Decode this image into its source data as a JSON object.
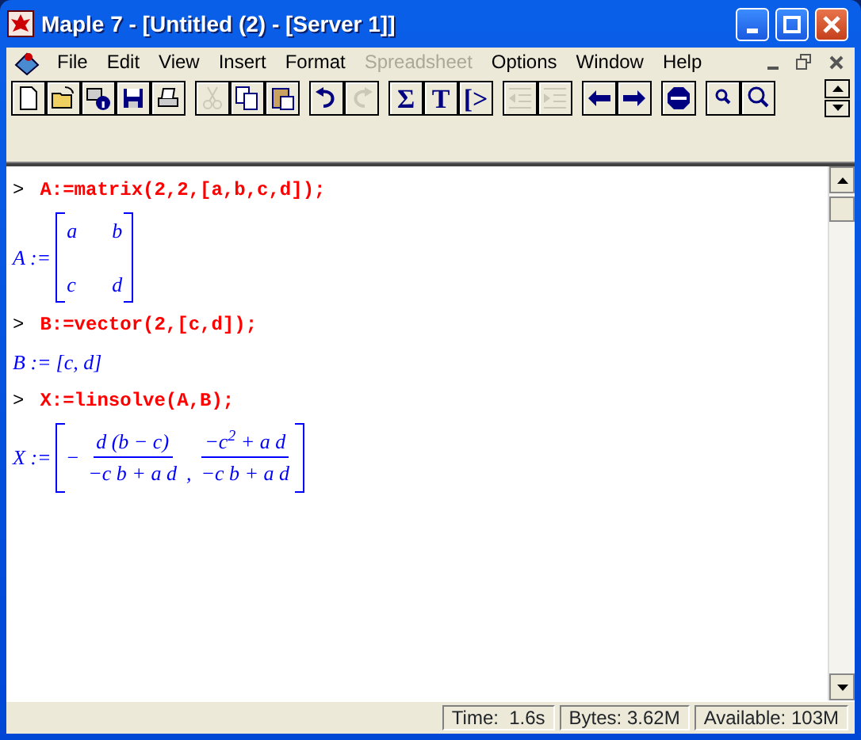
{
  "window": {
    "title": "Maple 7  - [Untitled (2) - [Server 1]]"
  },
  "menu": [
    {
      "label": "File",
      "disabled": false
    },
    {
      "label": "Edit",
      "disabled": false
    },
    {
      "label": "View",
      "disabled": false
    },
    {
      "label": "Insert",
      "disabled": false
    },
    {
      "label": "Format",
      "disabled": false
    },
    {
      "label": "Spreadsheet",
      "disabled": true
    },
    {
      "label": "Options",
      "disabled": false
    },
    {
      "label": "Window",
      "disabled": false
    },
    {
      "label": "Help",
      "disabled": false
    }
  ],
  "toolbar": [
    [
      {
        "kind": "new",
        "disabled": false
      },
      {
        "kind": "open",
        "disabled": false
      },
      {
        "kind": "info",
        "disabled": false
      },
      {
        "kind": "save",
        "disabled": false
      },
      {
        "kind": "print",
        "disabled": false
      }
    ],
    [
      {
        "kind": "cut",
        "disabled": true
      },
      {
        "kind": "copy",
        "disabled": false
      },
      {
        "kind": "paste",
        "disabled": false
      }
    ],
    [
      {
        "kind": "undo",
        "disabled": false
      },
      {
        "kind": "redo",
        "disabled": true
      }
    ],
    [
      {
        "kind": "glyph",
        "glyph": "Σ",
        "disabled": false
      },
      {
        "kind": "glyph",
        "glyph": "T",
        "disabled": false
      },
      {
        "kind": "glyph",
        "glyph": "[>",
        "disabled": false
      }
    ],
    [
      {
        "kind": "outdent",
        "disabled": true
      },
      {
        "kind": "indent",
        "disabled": true
      }
    ],
    [
      {
        "kind": "back",
        "disabled": false
      },
      {
        "kind": "forward",
        "disabled": false
      }
    ],
    [
      {
        "kind": "stop",
        "disabled": false
      }
    ],
    [
      {
        "kind": "zoom-in",
        "disabled": false
      },
      {
        "kind": "zoom-out",
        "disabled": false
      }
    ]
  ],
  "worksheet": [
    {
      "kind": "input",
      "prompt": ">",
      "code": "A:=matrix(2,2,[a,b,c,d]);"
    },
    {
      "kind": "matrix",
      "lhs": "A :=",
      "rows": [
        [
          "a",
          "b"
        ],
        [
          "c",
          "d"
        ]
      ]
    },
    {
      "kind": "input",
      "prompt": ">",
      "code": "B:=vector(2,[c,d]);"
    },
    {
      "kind": "plain",
      "lhs": "B :=",
      "value": "[c, d]"
    },
    {
      "kind": "input",
      "prompt": ">",
      "code": "X:=linsolve(A,B);"
    },
    {
      "kind": "vector",
      "lhs": "X :=",
      "elements": [
        {
          "sign": "−",
          "numerator": "d (b − c)",
          "denominator": "−c b + a d",
          "separator": ","
        },
        {
          "numerator": "−c$^{2}$ + a d",
          "denominator": "−c b + a d"
        }
      ]
    }
  ],
  "status_bar": [
    "Time:  1.6s",
    "Bytes: 3.62M",
    "Available: 103M"
  ]
}
